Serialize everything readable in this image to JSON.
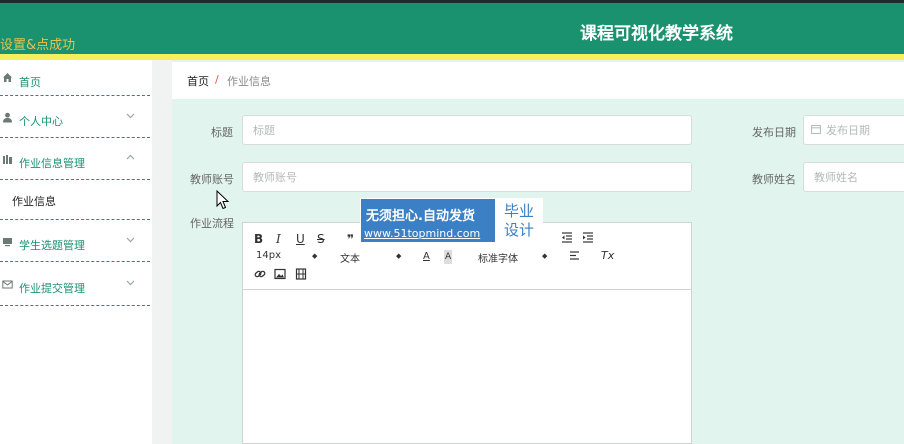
{
  "header": {
    "status_message": "设置&点成功",
    "app_title": "课程可视化教学系统",
    "colors": {
      "primary": "#1a9270",
      "strip": "#f4ef5b",
      "message": "#e9c24a"
    }
  },
  "sidebar": {
    "items": [
      {
        "label": "首页",
        "icon": "home-icon"
      },
      {
        "label": "个人中心",
        "icon": "user-icon"
      },
      {
        "label": "作业信息管理",
        "icon": "book-icon",
        "expanded": true
      },
      {
        "label": "作业信息"
      },
      {
        "label": "学生选题管理",
        "icon": "monitor-icon"
      },
      {
        "label": "作业提交管理",
        "icon": "mail-icon"
      }
    ]
  },
  "breadcrumb": {
    "home": "首页",
    "separator": "/",
    "current": "作业信息"
  },
  "form": {
    "title": {
      "label": "标题",
      "placeholder": "标题",
      "value": ""
    },
    "publish_date": {
      "label": "发布日期",
      "placeholder": "发布日期",
      "value": ""
    },
    "teacher_account": {
      "label": "教师账号",
      "placeholder": "教师账号",
      "value": ""
    },
    "teacher_name": {
      "label": "教师姓名",
      "placeholder": "教师姓名",
      "value": ""
    },
    "process": {
      "label": "作业流程"
    }
  },
  "editor": {
    "toolbar": {
      "bold": "B",
      "italic": "I",
      "underline": "U",
      "strike": "S",
      "quote": "❞",
      "font_size": "14px",
      "text_type": "文本",
      "font_color": "A",
      "font_bg": "A",
      "font_family": "标准字体",
      "clear": "Tx"
    }
  },
  "watermark": {
    "line1": "无须担心.自动发货",
    "line2": "www.51topmind.com",
    "badge_top": "毕业",
    "badge_bottom": "设计"
  }
}
